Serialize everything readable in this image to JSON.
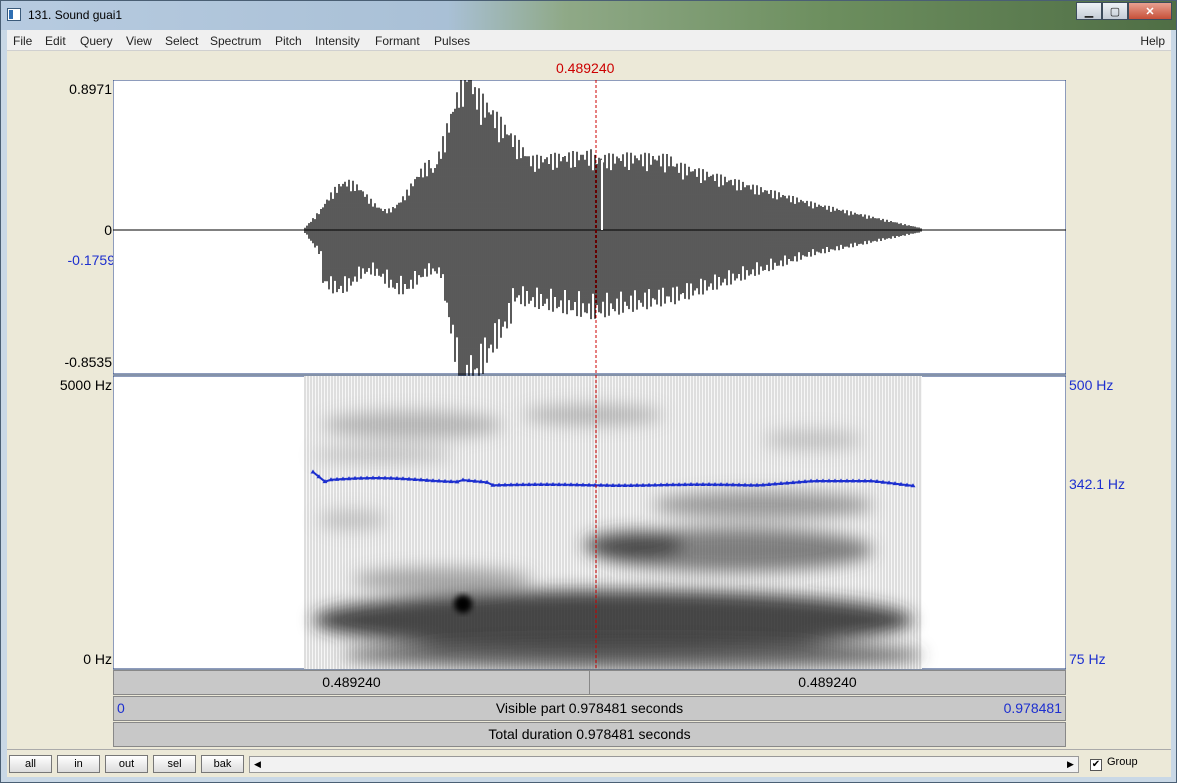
{
  "window": {
    "title": "131. Sound guai1",
    "controls": {
      "minimize": "▁",
      "maximize": "▢",
      "close": "✕"
    }
  },
  "menu": {
    "items": [
      "File",
      "Edit",
      "Query",
      "View",
      "Select",
      "Spectrum",
      "Pitch",
      "Intensity",
      "Formant",
      "Pulses"
    ],
    "help": "Help"
  },
  "cursor": {
    "time_label": "0.489240"
  },
  "waveform": {
    "y_max_label": "0.8971",
    "y_zero_label": "0",
    "y_cursor_value_label": "-0.1759",
    "y_min_label": "-0.8535"
  },
  "spectrogram": {
    "freq_top_label": "5000 Hz",
    "freq_bottom_label": "0 Hz",
    "pitch_top_label": "500 Hz",
    "pitch_value_label": "342.1 Hz",
    "pitch_bottom_label": "75 Hz",
    "pitch_color": "#1d2fcf"
  },
  "time_bars": {
    "left_segment": "0.489240",
    "right_segment": "0.489240",
    "visible_start": "0",
    "visible_text": "Visible part 0.978481 seconds",
    "visible_end": "0.978481",
    "total_text": "Total duration 0.978481 seconds"
  },
  "bottom": {
    "buttons": [
      "all",
      "in",
      "out",
      "sel",
      "bak"
    ],
    "scroll_left": "◀",
    "scroll_right": "▶",
    "group_checked": "✔",
    "group_label": "Group"
  }
}
